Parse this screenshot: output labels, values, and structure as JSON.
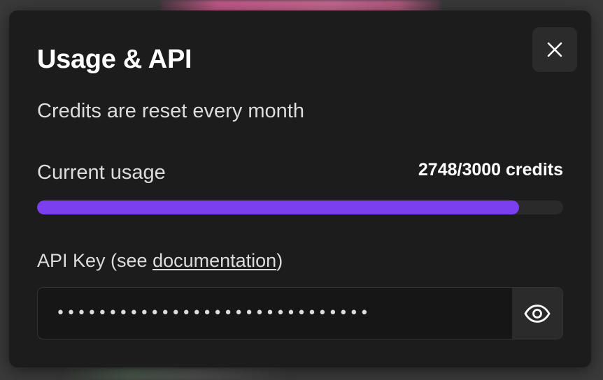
{
  "modal": {
    "title": "Usage & API",
    "subtitle": "Credits are reset every month",
    "close_icon": "close-icon"
  },
  "usage": {
    "label": "Current usage",
    "value_text": "2748/3000 credits",
    "used": 2748,
    "total": 3000,
    "bar_color": "#7b3ff0"
  },
  "api_key": {
    "label_prefix": "API Key (see ",
    "link_text": "documentation",
    "label_suffix": ")",
    "masked_value": "••••••••••••••••••••••••••••••",
    "toggle_icon": "eye-icon"
  }
}
